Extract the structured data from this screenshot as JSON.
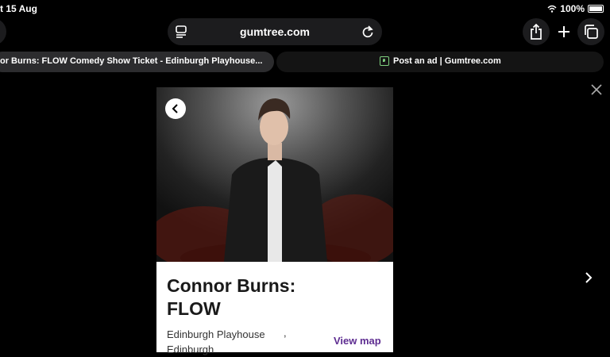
{
  "status": {
    "time": "t 15 Aug",
    "battery": "100%"
  },
  "browser": {
    "url": "gumtree.com",
    "tabs": [
      {
        "label": "or Burns: FLOW Comedy Show Ticket - Edinburgh Playhouse..."
      },
      {
        "label": "Post an ad | Gumtree.com"
      }
    ]
  },
  "event": {
    "title": "Connor Burns: FLOW",
    "venue_line1": "Edinburgh Playhouse",
    "venue_comma": ",",
    "venue_line2": "Edinburgh",
    "view_map": "View map"
  },
  "colors": {
    "accent": "#5e2d91",
    "background": "#000000"
  }
}
